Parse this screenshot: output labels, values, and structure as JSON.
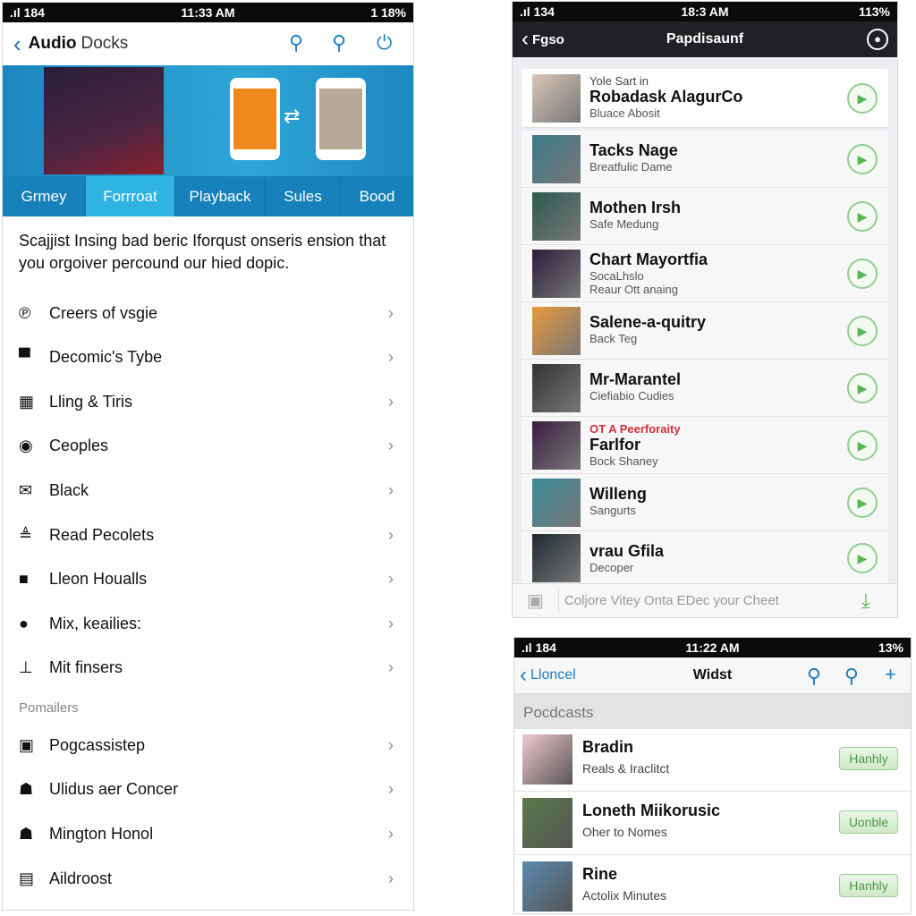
{
  "left_screen": {
    "status": {
      "carrier": ".ıl 184",
      "time": "11:33 AM",
      "battery": "1 18%"
    },
    "header": {
      "title_bold": "Audio",
      "title_rest": "Docks",
      "icons": [
        "search-icon",
        "search-icon",
        "power-icon"
      ]
    },
    "tabs": [
      {
        "label": "Grmey"
      },
      {
        "label": "Forrroat",
        "active": true
      },
      {
        "label": "Playback"
      },
      {
        "label": "Sules"
      },
      {
        "label": "Bood"
      }
    ],
    "description": "Scajjist Insing bad beric Iforqust onseris ension that you orgoiver percound our hied dopic.",
    "items": [
      {
        "label": "Creers of vsgie",
        "icon": "pinterest-icon",
        "glyph": "℗"
      },
      {
        "label": "Decomic's Tybe",
        "icon": "film-icon",
        "glyph": "▀"
      },
      {
        "label": "Lling & Tiris",
        "icon": "grid-icon",
        "glyph": "▦"
      },
      {
        "label": "Ceoples",
        "icon": "target-icon",
        "glyph": "◉"
      },
      {
        "label": "Black",
        "icon": "envelope-icon",
        "glyph": "✉"
      },
      {
        "label": "Read Pecolets",
        "icon": "stack-icon",
        "glyph": "≜"
      },
      {
        "label": "Lleon Houalls",
        "icon": "bag-icon",
        "glyph": "■"
      },
      {
        "label": "Mix, keailies:",
        "icon": "pin-icon",
        "glyph": "●"
      },
      {
        "label": "Mit finsers",
        "icon": "download-icon",
        "glyph": "⊥"
      }
    ],
    "section": "Pomailers",
    "items2": [
      {
        "label": "Pogcassistep",
        "icon": "device-icon",
        "glyph": "▣"
      },
      {
        "label": "Ulidus aer Concer",
        "icon": "person-icon",
        "glyph": "☗"
      },
      {
        "label": "Mington Honol",
        "icon": "person-icon",
        "glyph": "☗"
      },
      {
        "label": "Aildroost",
        "icon": "keyboard-icon",
        "glyph": "▤"
      }
    ]
  },
  "right_top_screen": {
    "status": {
      "carrier": ".ıl 134",
      "time": "18:3 AM",
      "battery": "113%"
    },
    "header": {
      "back": "Fgso",
      "title": "Papdisaunf"
    },
    "rows": [
      {
        "pre": "Yole Sart in",
        "title": "Robadask AlagurCo",
        "sub": "Bluace Abosit"
      },
      {
        "title": "Tacks Nage",
        "sub": "Breatfulic Dame"
      },
      {
        "title": "Mothen Irsh",
        "sub": "Safe Medung"
      },
      {
        "title": "Chart Mayortfia",
        "sub": "SocaLhslo",
        "sub2": "Reaur Ott anaing"
      },
      {
        "title": "Salene-a-quitry",
        "sub": "Back Teg"
      },
      {
        "title": "Mr-Marantel",
        "sub": "Ciefiabio Cudies"
      },
      {
        "pre": "OT A Peerforaity",
        "title": "Farlfor",
        "sub": "Bock Shaney"
      },
      {
        "title": "Willeng",
        "sub": "Sangurts"
      },
      {
        "title": "vrau Gfila",
        "sub": "Decoper"
      }
    ],
    "bottom_placeholder": "Coljore Vitey Onta EDec your Cheet",
    "accent": "#55b850"
  },
  "right_bottom_screen": {
    "status": {
      "carrier": ".ıl 184",
      "time": "11:22 AM",
      "battery": "13%"
    },
    "header": {
      "back": "Lloncel",
      "title": "Widst"
    },
    "section": "Pocdcasts",
    "rows": [
      {
        "title": "Bradin",
        "sub": "Reals & Iraclitct",
        "button": "Hanhly"
      },
      {
        "title": "Loneth Miikorusic",
        "sub": "Oher to Nomes",
        "button": "Uonble"
      },
      {
        "title": "Rine",
        "sub": "Actolix Minutes",
        "button": "Hanhly"
      }
    ]
  }
}
